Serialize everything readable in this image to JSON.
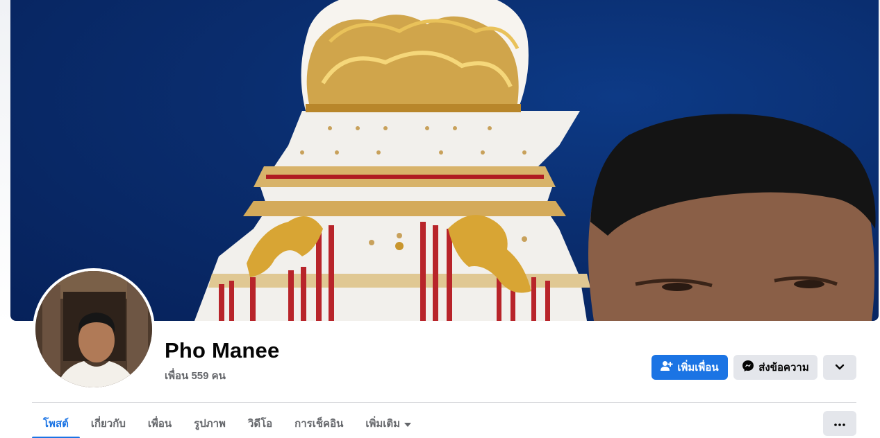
{
  "profile": {
    "name": "Pho Manee",
    "friends_count": "เพื่อน 559 คน"
  },
  "actions": {
    "add_friend_label": "เพิ่มเพื่อน",
    "message_label": "ส่งข้อความ",
    "more_icon": "chevron-down-icon"
  },
  "tabs": [
    {
      "label": "โพสต์",
      "active": true
    },
    {
      "label": "เกี่ยวกับ",
      "active": false
    },
    {
      "label": "เพื่อน",
      "active": false
    },
    {
      "label": "รูปภาพ",
      "active": false
    },
    {
      "label": "วิดีโอ",
      "active": false
    },
    {
      "label": "การเช็คอิน",
      "active": false
    },
    {
      "label": "เพิ่มเติม",
      "active": false
    }
  ],
  "tab_options_icon": "ellipsis-icon",
  "colors": {
    "accent": "#1b74e4",
    "secondary_button": "#e4e6eb",
    "muted_text": "#65676b",
    "sky": "#0a2d6e"
  }
}
